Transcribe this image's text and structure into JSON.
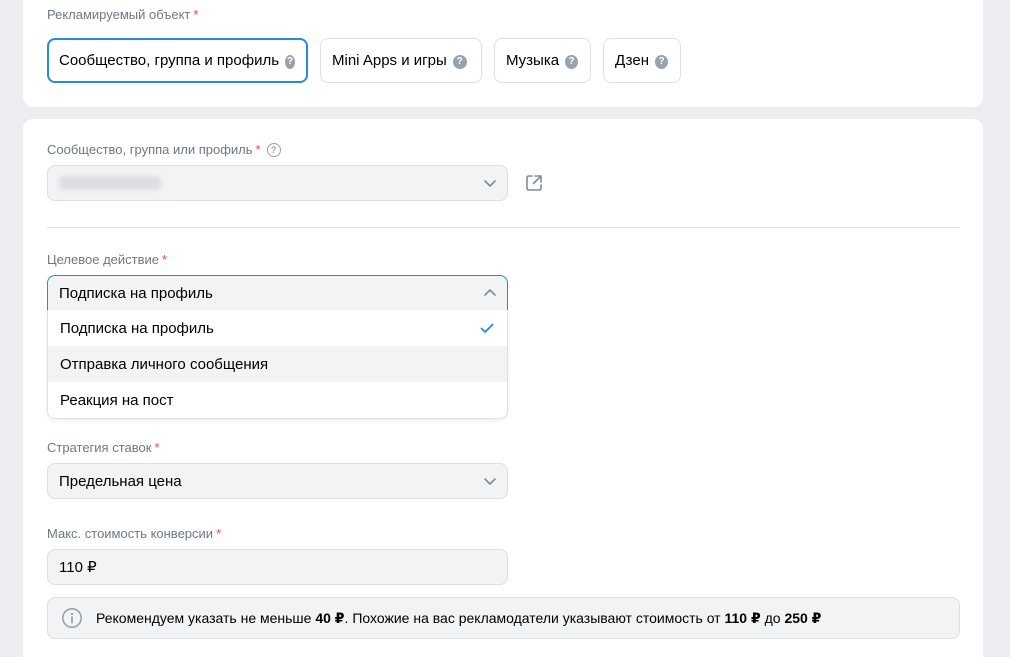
{
  "object_section": {
    "label": "Рекламируемый объект",
    "required_mark": "*",
    "chips": [
      {
        "label": "Сообщество, группа и профиль",
        "active": true
      },
      {
        "label": "Mini Apps и игры",
        "active": false
      },
      {
        "label": "Музыка",
        "active": false
      },
      {
        "label": "Дзен",
        "active": false
      }
    ],
    "help_glyph": "?"
  },
  "community_field": {
    "label": "Сообщество, группа или профиль",
    "required_mark": "*",
    "help_glyph": "?",
    "value_hidden": true
  },
  "target_action": {
    "label": "Целевое действие",
    "required_mark": "*",
    "selected": "Подписка на профиль",
    "options": [
      {
        "label": "Подписка на профиль",
        "checked": true
      },
      {
        "label": "Отправка личного сообщения",
        "checked": false
      },
      {
        "label": "Реакция на пост",
        "checked": false
      }
    ]
  },
  "bid_strategy": {
    "label": "Стратегия ставок",
    "required_mark": "*",
    "selected": "Предельная цена"
  },
  "max_cost": {
    "label": "Макс. стоимость конверсии",
    "required_mark": "*",
    "value": "110 ₽"
  },
  "recommendation": {
    "text_1": "Рекомендуем указать не меньше ",
    "min_value": "40 ₽",
    "text_2": ". Похожие на вас рекламодатели указывают стоимость от ",
    "from_value": "110 ₽",
    "text_3": " до ",
    "to_value": "250 ₽"
  },
  "colors": {
    "accent": "#2688eb",
    "required": "#e64646",
    "secondary_text": "#6d7885",
    "field_bg": "#f2f3f5",
    "page_bg": "#ebedf0"
  },
  "icons": [
    "question-icon",
    "chevron-down-icon",
    "chevron-up-icon",
    "external-link-icon",
    "checkmark-icon",
    "info-icon"
  ]
}
